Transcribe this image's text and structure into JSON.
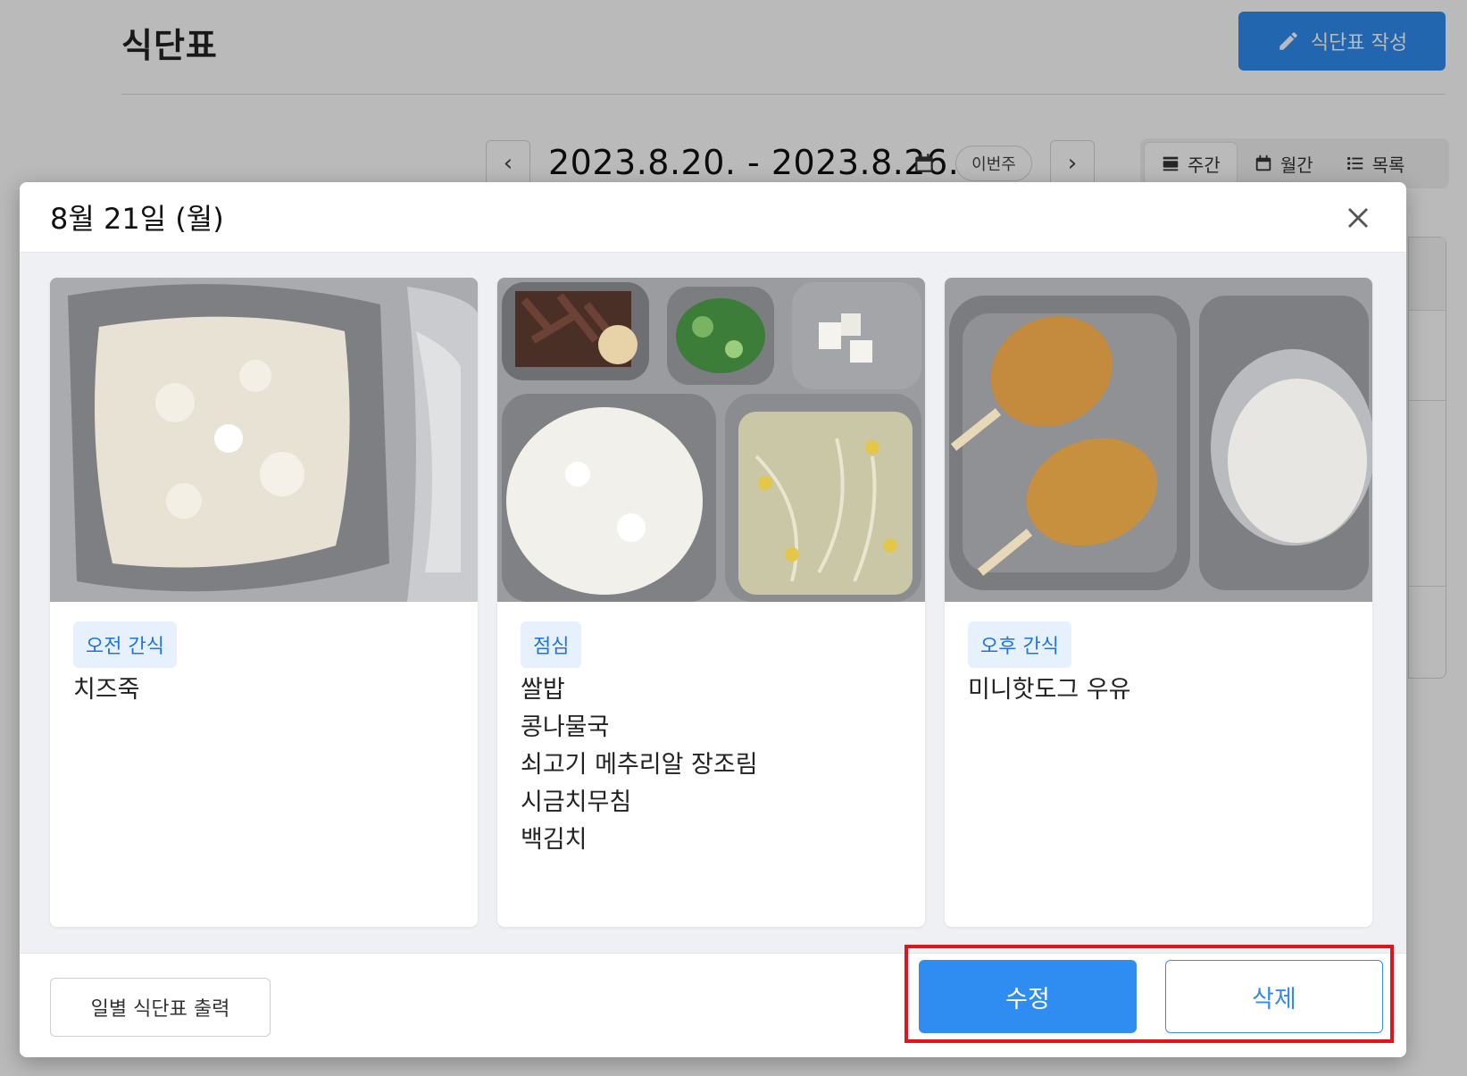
{
  "page": {
    "title": "식단표",
    "write_button": "식단표 작성",
    "date_range": "2023.8.20. - 2023.8.26.",
    "this_week": "이번주",
    "prev": "‹",
    "next": "›",
    "views": [
      {
        "label": "주간",
        "icon": "week-view-icon",
        "active": true
      },
      {
        "label": "월간",
        "icon": "calendar-icon",
        "active": false
      },
      {
        "label": "목록",
        "icon": "list-icon",
        "active": false
      }
    ]
  },
  "modal": {
    "title": "8월 21일 (월)",
    "meals": [
      {
        "tag": "오전 간식",
        "photo": "porridge-photo",
        "items": [
          "치즈죽"
        ]
      },
      {
        "tag": "점심",
        "photo": "lunch-tray-photo",
        "items": [
          "쌀밥",
          "콩나물국",
          "쇠고기 메추리알 장조림",
          "시금치무침",
          "백김치"
        ]
      },
      {
        "tag": "오후 간식",
        "photo": "hotdog-milk-photo",
        "items": [
          "미니핫도그 우유"
        ]
      }
    ],
    "footer": {
      "print": "일별 식단표 출력",
      "edit": "수정",
      "delete": "삭제"
    }
  },
  "colors": {
    "primary": "#2f8df2",
    "tag_bg": "#e7f1fd",
    "tag_text": "#1f74de",
    "highlight": "#e4121b"
  }
}
